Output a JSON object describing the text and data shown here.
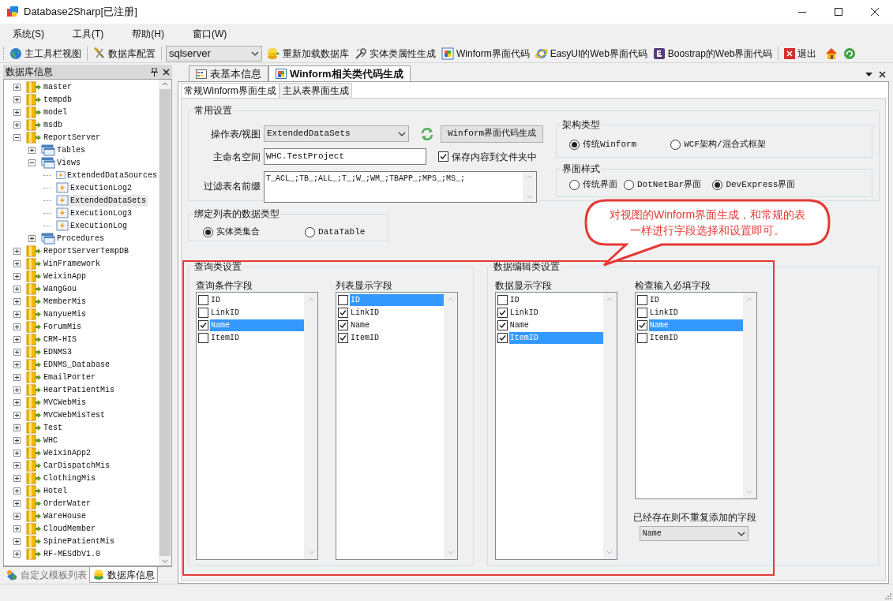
{
  "window": {
    "title": "Database2Sharp[已注册]"
  },
  "menu": [
    "系统(S)",
    "工具(T)",
    "帮助(H)",
    "窗口(W)"
  ],
  "toolbar": [
    {
      "kind": "button",
      "label": "主工具栏视图"
    },
    {
      "kind": "button",
      "label": "数据库配置"
    },
    {
      "kind": "combo",
      "value": "sqlserver"
    },
    {
      "kind": "button",
      "label": "重新加载数据库"
    },
    {
      "kind": "button",
      "label": "实体类属性生成"
    },
    {
      "kind": "button",
      "label": "Winform界面代码"
    },
    {
      "kind": "button",
      "label": "EasyUI的Web界面代码"
    },
    {
      "kind": "button",
      "label": "Boostrap的Web界面代码"
    },
    {
      "kind": "button",
      "label": "退出"
    }
  ],
  "left_panel": {
    "title": "数据库信息",
    "tree": [
      {
        "label": "master",
        "kind": "database",
        "expanded": false,
        "selected": false
      },
      {
        "label": "tempdb",
        "kind": "database",
        "expanded": false,
        "selected": false
      },
      {
        "label": "model",
        "kind": "database",
        "expanded": false,
        "selected": false
      },
      {
        "label": "msdb",
        "kind": "database",
        "expanded": false,
        "selected": false
      },
      {
        "label": "ReportServer",
        "kind": "database",
        "expanded": true,
        "selected": false,
        "children": [
          {
            "label": "Tables",
            "kind": "folder",
            "expanded": false,
            "selected": false
          },
          {
            "label": "Views",
            "kind": "folder",
            "expanded": true,
            "selected": false,
            "children": [
              {
                "label": "ExtendedDataSources",
                "kind": "view",
                "selected": false
              },
              {
                "label": "ExecutionLog2",
                "kind": "view",
                "selected": false
              },
              {
                "label": "ExtendedDataSets",
                "kind": "view",
                "selected": true
              },
              {
                "label": "ExecutionLog3",
                "kind": "view",
                "selected": false
              },
              {
                "label": "ExecutionLog",
                "kind": "view",
                "selected": false
              }
            ]
          },
          {
            "label": "Procedures",
            "kind": "folder",
            "expanded": false,
            "selected": false
          }
        ]
      },
      {
        "label": "ReportServerTempDB",
        "kind": "database",
        "expanded": false,
        "selected": false
      },
      {
        "label": "WinFramework",
        "kind": "database",
        "expanded": false,
        "selected": false
      },
      {
        "label": "WeixinApp",
        "kind": "database",
        "expanded": false,
        "selected": false
      },
      {
        "label": "WangGou",
        "kind": "database",
        "expanded": false,
        "selected": false
      },
      {
        "label": "MemberMis",
        "kind": "database",
        "expanded": false,
        "selected": false
      },
      {
        "label": "NanyueMis",
        "kind": "database",
        "expanded": false,
        "selected": false
      },
      {
        "label": "ForumMis",
        "kind": "database",
        "expanded": false,
        "selected": false
      },
      {
        "label": "CRM-HIS",
        "kind": "database",
        "expanded": false,
        "selected": false
      },
      {
        "label": "EDNMS3",
        "kind": "database",
        "expanded": false,
        "selected": false
      },
      {
        "label": "EDNMS_Database",
        "kind": "database",
        "expanded": false,
        "selected": false
      },
      {
        "label": "EmailPorter",
        "kind": "database",
        "expanded": false,
        "selected": false
      },
      {
        "label": "HeartPatientMis",
        "kind": "database",
        "expanded": false,
        "selected": false
      },
      {
        "label": "MVCWebMis",
        "kind": "database",
        "expanded": false,
        "selected": false
      },
      {
        "label": "MVCWebMisTest",
        "kind": "database",
        "expanded": false,
        "selected": false
      },
      {
        "label": "Test",
        "kind": "database",
        "expanded": false,
        "selected": false
      },
      {
        "label": "WHC",
        "kind": "database",
        "expanded": false,
        "selected": false
      },
      {
        "label": "WeixinApp2",
        "kind": "database",
        "expanded": false,
        "selected": false
      },
      {
        "label": "CarDispatchMis",
        "kind": "database",
        "expanded": false,
        "selected": false
      },
      {
        "label": "ClothingMis",
        "kind": "database",
        "expanded": false,
        "selected": false
      },
      {
        "label": "Hotel",
        "kind": "database",
        "expanded": false,
        "selected": false
      },
      {
        "label": "OrderWater",
        "kind": "database",
        "expanded": false,
        "selected": false
      },
      {
        "label": "WareHouse",
        "kind": "database",
        "expanded": false,
        "selected": false
      },
      {
        "label": "CloudMember",
        "kind": "database",
        "expanded": false,
        "selected": false
      },
      {
        "label": "SpinePatientMis",
        "kind": "database",
        "expanded": false,
        "selected": false
      },
      {
        "label": "RF-MESdbV1.0",
        "kind": "database",
        "expanded": false,
        "selected": false
      }
    ],
    "tabs": [
      {
        "label": "自定义模板列表",
        "selected": false
      },
      {
        "label": "数据库信息",
        "selected": true
      }
    ]
  },
  "doc_tabs": [
    {
      "label": "表基本信息",
      "selected": false
    },
    {
      "label": "Winform相关类代码生成",
      "selected": true
    }
  ],
  "sub_tabs": [
    {
      "label": "常规Winform界面生成",
      "selected": true
    },
    {
      "label": "主从表界面生成",
      "selected": false
    }
  ],
  "common": {
    "title": "常用设置",
    "table_label": "操作表/视图",
    "table_value": "ExtendedDataSets",
    "generate_button": "Winform界面代码生成",
    "namespace_label": "主命名空间",
    "namespace_value": "WHC.TestProject",
    "save_checkbox": {
      "label": "保存内容到文件夹中",
      "checked": true
    },
    "prefix_label": "过滤表名前缀",
    "prefix_value": "T_ACL_;TB_;ALL_;T_;W_;WM_;TBAPP_;MPS_;MS_;"
  },
  "architecture": {
    "title": "架构类型",
    "options": [
      {
        "label": "传统Winform",
        "selected": true
      },
      {
        "label": "WCF架构/混合式框架",
        "selected": false
      }
    ]
  },
  "ui_style": {
    "title": "界面样式",
    "options": [
      {
        "label": "传统界面",
        "selected": false
      },
      {
        "label": "DotNetBar界面",
        "selected": false
      },
      {
        "label": "DevExpress界面",
        "selected": true
      }
    ]
  },
  "binding": {
    "title": "绑定列表的数据类型",
    "options": [
      {
        "label": "实体类集合",
        "selected": true
      },
      {
        "label": "DataTable",
        "selected": false
      }
    ]
  },
  "query": {
    "title": "查询类设置",
    "lists": [
      {
        "label": "查询条件字段",
        "items": [
          {
            "label": "ID",
            "checked": false,
            "selected": false
          },
          {
            "label": "LinkID",
            "checked": false,
            "selected": false
          },
          {
            "label": "Name",
            "checked": true,
            "selected": true
          },
          {
            "label": "ItemID",
            "checked": false,
            "selected": false
          }
        ]
      },
      {
        "label": "列表显示字段",
        "items": [
          {
            "label": "ID",
            "checked": false,
            "selected": true
          },
          {
            "label": "LinkID",
            "checked": true,
            "selected": false
          },
          {
            "label": "Name",
            "checked": true,
            "selected": false
          },
          {
            "label": "ItemID",
            "checked": true,
            "selected": false
          }
        ]
      }
    ]
  },
  "edit": {
    "title": "数据编辑类设置",
    "lists": [
      {
        "label": "数据显示字段",
        "items": [
          {
            "label": "ID",
            "checked": false,
            "selected": false
          },
          {
            "label": "LinkID",
            "checked": true,
            "selected": false
          },
          {
            "label": "Name",
            "checked": true,
            "selected": false
          },
          {
            "label": "ItemID",
            "checked": true,
            "selected": true
          }
        ]
      },
      {
        "label": "检查输入必填字段",
        "items": [
          {
            "label": "ID",
            "checked": false,
            "selected": false
          },
          {
            "label": "LinkID",
            "checked": false,
            "selected": false
          },
          {
            "label": "Name",
            "checked": true,
            "selected": true
          },
          {
            "label": "ItemID",
            "checked": false,
            "selected": false
          }
        ]
      }
    ],
    "dedupe_label": "已经存在则不重复添加的字段",
    "dedupe_value": "Name"
  },
  "callout": {
    "text": "对视图的Winform界面生成，和常规的表一样进行字段选择和设置即可。"
  }
}
